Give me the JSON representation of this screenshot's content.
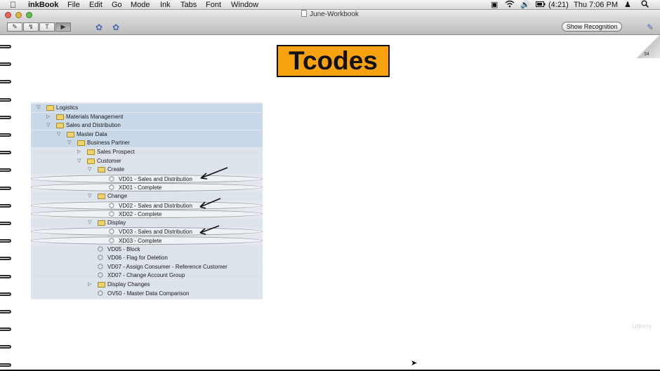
{
  "menubar": {
    "apple_icon": "apple-icon",
    "items": [
      "inkBook",
      "File",
      "Edit",
      "Go",
      "Mode",
      "Ink",
      "Tabs",
      "Font",
      "Window"
    ],
    "battery": "(4:21)",
    "clock": "Thu 7:06 PM"
  },
  "window": {
    "title": "June-Workbook"
  },
  "toolbar": {
    "show_recognition": "Show Recognition",
    "text_tool": "T"
  },
  "page": {
    "number": "34",
    "heading": "Tcodes",
    "watermark": "Udemy"
  },
  "tree": {
    "rows": [
      {
        "label": "Logistics",
        "icon": "folder",
        "expander": "open",
        "style": "band"
      },
      {
        "label": "Materials Management",
        "icon": "folder",
        "expander": "closed",
        "style": "band"
      },
      {
        "label": "Sales and Distribution",
        "icon": "folder",
        "expander": "open",
        "style": "band"
      },
      {
        "label": "Master Data",
        "icon": "folder",
        "expander": "open",
        "style": "band"
      },
      {
        "label": "Business Partner",
        "icon": "folder",
        "expander": "open",
        "style": "band"
      },
      {
        "label": "Sales Prospect",
        "icon": "folder",
        "expander": "closed",
        "style": "mid"
      },
      {
        "label": "Customer",
        "icon": "folder",
        "expander": "open",
        "style": "mid"
      },
      {
        "label": "Create",
        "icon": "folder",
        "expander": "open",
        "style": "mid"
      },
      {
        "label": "VD01 - Sales and Distribution",
        "icon": "transaction",
        "expander": "none",
        "style": "light"
      },
      {
        "label": "XD01 - Complete",
        "icon": "transaction",
        "expander": "none",
        "style": "light"
      },
      {
        "label": "Change",
        "icon": "folder",
        "expander": "open",
        "style": "mid"
      },
      {
        "label": "VD02 - Sales and Distribution",
        "icon": "transaction",
        "expander": "none",
        "style": "light"
      },
      {
        "label": "XD02 - Complete",
        "icon": "transaction",
        "expander": "none",
        "style": "light"
      },
      {
        "label": "Display",
        "icon": "folder",
        "expander": "open",
        "style": "mid"
      },
      {
        "label": "VD03 - Sales and Distribution",
        "icon": "transaction",
        "expander": "none",
        "style": "light"
      },
      {
        "label": "XD03 - Complete",
        "icon": "transaction",
        "expander": "none",
        "style": "light"
      },
      {
        "label": "VD05 - Block",
        "icon": "transaction",
        "expander": "none",
        "style": "mid"
      },
      {
        "label": "VD06 - Flag for Deletion",
        "icon": "transaction",
        "expander": "none",
        "style": "mid"
      },
      {
        "label": "VD07 - Assign Consumer - Reference Customer",
        "icon": "transaction",
        "expander": "none",
        "style": "mid"
      },
      {
        "label": "XD07 - Change Account Group",
        "icon": "transaction",
        "expander": "none",
        "style": "mid"
      },
      {
        "label": "Display Changes",
        "icon": "folder",
        "expander": "closed",
        "style": "mid"
      },
      {
        "label": "OV50 - Master Data Comparison",
        "icon": "transaction",
        "expander": "none",
        "style": "mid"
      }
    ]
  },
  "colors": {
    "tcodes_bg": "#f7a20f",
    "tree_band": "#c9d9ea",
    "folder": "#f0d26a"
  }
}
